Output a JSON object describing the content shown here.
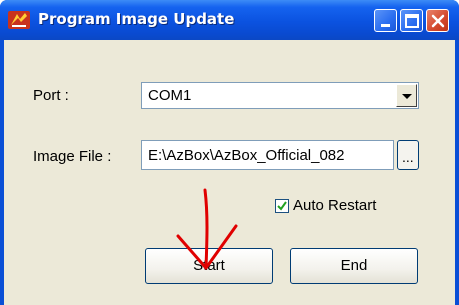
{
  "window": {
    "title": "Program Image Update",
    "app_icon": "app-logo-icon",
    "controls": [
      "minimize-icon",
      "maximize-icon",
      "close-icon"
    ]
  },
  "form": {
    "port_label": "Port :",
    "port_value": "COM1",
    "image_file_label": "Image File :",
    "image_file_value": "E:\\AzBox\\AzBox_Official_082",
    "browse_label": "...",
    "auto_restart_label": "Auto Restart",
    "auto_restart_checked": true
  },
  "buttons": {
    "start_label": "Start",
    "end_label": "End"
  },
  "colors": {
    "titlebar": "#0b52e0",
    "client": "#ece9d8",
    "close_button": "#d3492d",
    "annotation_arrow": "#e00000"
  }
}
